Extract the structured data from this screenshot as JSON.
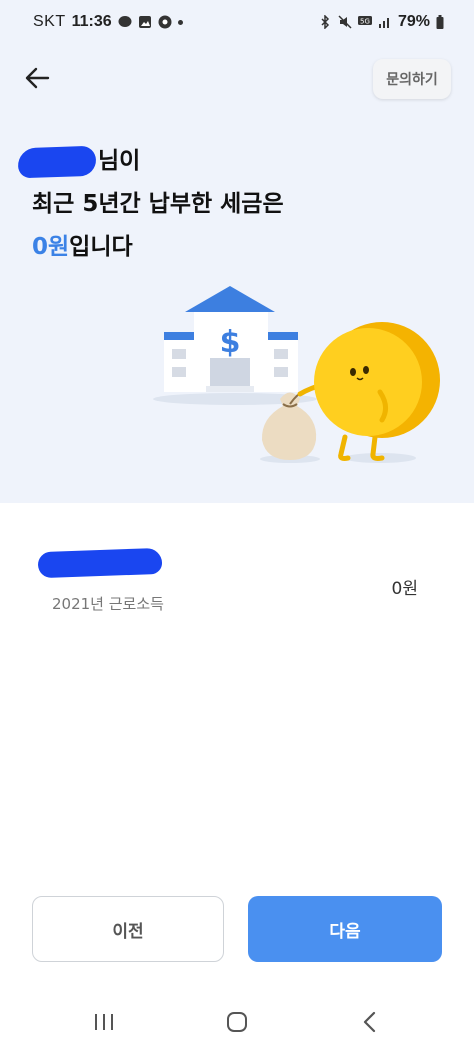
{
  "status_bar": {
    "carrier": "SKT",
    "time": "11:36",
    "battery_percent": "79%",
    "icons_left": [
      "talk-icon",
      "gallery-icon",
      "chrome-icon",
      "dot"
    ],
    "icons_right": [
      "bluetooth-icon",
      "mute-icon",
      "5g-icon",
      "signal-icon",
      "battery-icon"
    ]
  },
  "header": {
    "back_icon": "arrow-left-icon",
    "inquiry_label": "문의하기"
  },
  "headline": {
    "name_suffix": "님이",
    "line2": "최근 5년간 납부한 세금은",
    "amount": "0원",
    "line3_suffix": "입니다"
  },
  "illustration": {
    "description_icons": [
      "bank-icon",
      "money-bag-icon",
      "coin-character-icon"
    ]
  },
  "tax_item": {
    "subtitle": "2021년 근로소득",
    "amount": "0원"
  },
  "buttons": {
    "prev_label": "이전",
    "next_label": "다음"
  },
  "colors": {
    "accent": "#3b82e6",
    "next_button": "#4a90f0",
    "top_background": "#eff3fb",
    "redaction": "#1a46f0"
  },
  "nav_bar": {
    "icons": [
      "recents-icon",
      "home-icon",
      "back-icon"
    ]
  }
}
